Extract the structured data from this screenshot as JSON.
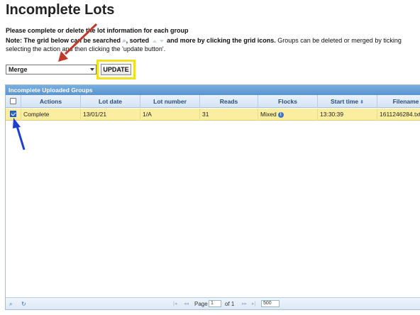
{
  "page": {
    "title": "Incomplete Lots",
    "instruction": "Please complete or delete the lot information for each group",
    "note_label": "Note:",
    "note_part1": "The grid below can be searched",
    "note_part2": ", sorted",
    "note_part3": "and more by clicking the grid icons.",
    "note_part4": "Groups can be deleted or merged by ticking",
    "note_line2": "selecting the action and then clicking the 'update button'."
  },
  "action_select": {
    "selected": "Merge"
  },
  "update_button": {
    "label": "UPDATE"
  },
  "grid": {
    "caption": "Incomplete Uploaded Groups",
    "columns": [
      "Actions",
      "Lot date",
      "Lot number",
      "Reads",
      "Flocks",
      "Start time",
      "Filename"
    ],
    "rows": [
      {
        "checked": true,
        "actions": "Complete",
        "lot_date": "13/01/21",
        "lot_number": "1/A",
        "reads": "31",
        "flocks": "Mixed",
        "start_time": "13:30:39",
        "filename": "1611246284.txt"
      }
    ],
    "pager": {
      "page_label": "Page",
      "page_value": "1",
      "of_label": "of 1",
      "rows_per_page": "500"
    }
  },
  "colors": {
    "caption_bg": "#5a93cd",
    "selected_row": "#fbeea0",
    "highlight_box": "#f0e020",
    "arrow_red": "#c0392b",
    "arrow_blue": "#1f3fd0"
  },
  "icons": [
    "search-icon",
    "sort-icon",
    "refresh-icon",
    "info-icon",
    "select-arrow-icon",
    "pager-first-icon",
    "pager-prev-icon",
    "pager-next-icon",
    "pager-last-icon"
  ]
}
